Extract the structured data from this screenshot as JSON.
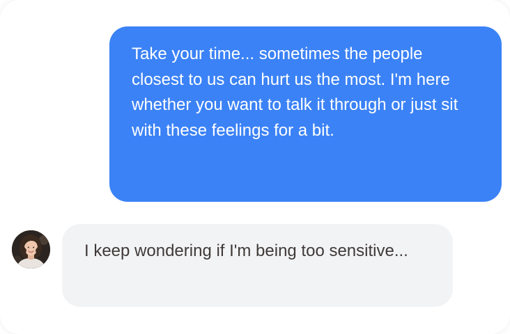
{
  "conversation": {
    "messages": [
      {
        "sender": "user",
        "text": "Take your time... sometimes the people closest to us can hurt us the most. I'm here whether you want to talk it through or just sit with these feelings for a bit."
      },
      {
        "sender": "contact",
        "text": "I keep wondering if I'm being too sensitive..."
      }
    ]
  },
  "colors": {
    "sent_bubble": "#3b82f6",
    "received_bubble": "#f2f3f5",
    "sent_text": "#ffffff",
    "received_text": "#3f3a38"
  },
  "icons": {
    "contact_avatar": "avatar-photo-icon"
  }
}
